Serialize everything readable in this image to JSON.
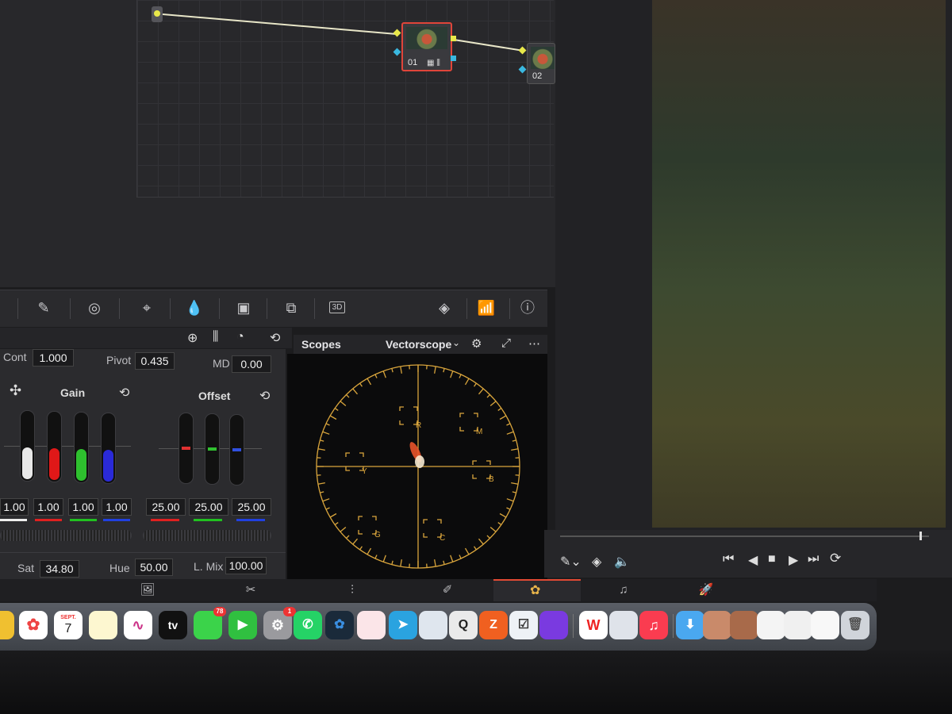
{
  "node_editor": {
    "nodes": [
      {
        "label": "01"
      },
      {
        "label": "02"
      }
    ]
  },
  "toolbar": {
    "tools": [
      "curves-icon",
      "color-picker-icon",
      "power-window-icon",
      "tracker-icon",
      "blur-icon",
      "key-icon",
      "sizing-icon",
      "3d-label"
    ],
    "three_d_label": "3D"
  },
  "scopes": {
    "title": "Scopes",
    "mode": "Vectorscope",
    "targets": [
      "R",
      "M",
      "Y",
      "B",
      "G",
      "C"
    ]
  },
  "primaries": {
    "cont_label": "Cont",
    "cont_value": "1.000",
    "pivot_label": "Pivot",
    "pivot_value": "0.435",
    "md_label": "MD",
    "md_value": "0.00",
    "gain_title": "Gain",
    "offset_title": "Offset",
    "gain_values": [
      "1.00",
      "1.00",
      "1.00",
      "1.00"
    ],
    "offset_values": [
      "25.00",
      "25.00",
      "25.00"
    ],
    "sat_label": "Sat",
    "sat_value": "34.80",
    "hue_label": "Hue",
    "hue_value": "50.00",
    "lmix_label": "L. Mix",
    "lmix_value": "100.00"
  },
  "page_bar": {
    "pages": [
      "media-page-icon",
      "cut-page-icon",
      "edit-page-icon",
      "fusion-page-icon",
      "color-page-icon",
      "fairlight-page-icon",
      "deliver-page-icon"
    ],
    "active": "color-page-icon"
  },
  "dock": {
    "calendar_month": "SEPT.",
    "calendar_day": "7",
    "tv_label": "tv",
    "messages_badge": "78",
    "settings_badge": "1",
    "wps_label": "W"
  },
  "colors": {
    "accent": "#e0b84a",
    "scope_graticule": "#d9a53c",
    "node_selected": "#e0453a",
    "active_page": "#e24a34"
  }
}
